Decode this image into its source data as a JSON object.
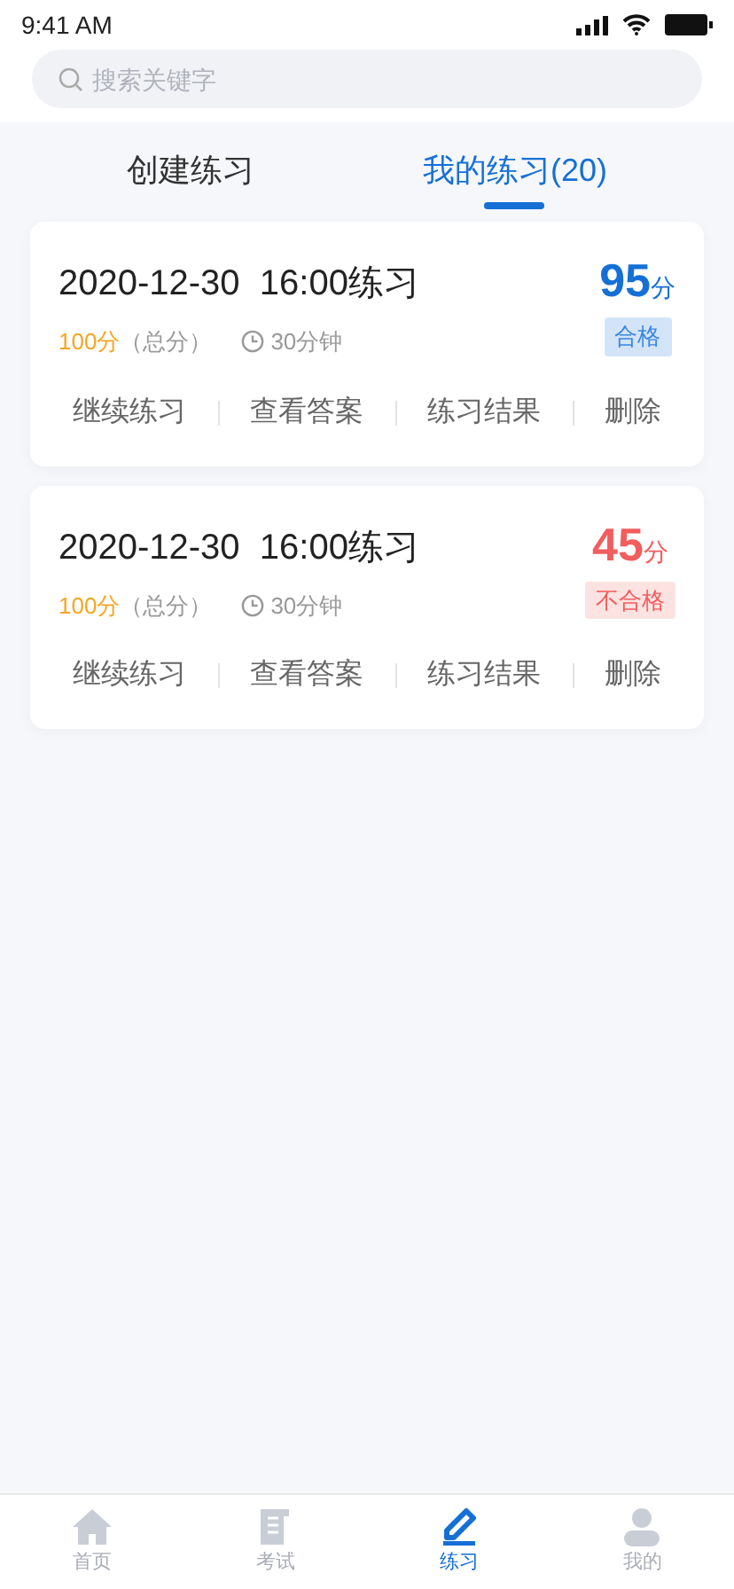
{
  "status_bar": {
    "time": "9:41 AM"
  },
  "search": {
    "placeholder": "搜索关键字"
  },
  "tabs": [
    {
      "label": "创建练习",
      "selected": false
    },
    {
      "label": "我的练习(20)",
      "selected": true
    }
  ],
  "records": [
    {
      "title": "2020-12-30  16:00练习",
      "total": "100分",
      "total_note": "（总分）",
      "duration": "30分钟",
      "score": "95",
      "score_unit": "分",
      "result": "合格",
      "passed": true,
      "actions": [
        "继续练习",
        "查看答案",
        "练习结果",
        "删除"
      ]
    },
    {
      "title": "2020-12-30  16:00练习",
      "total": "100分",
      "total_note": "（总分）",
      "duration": "30分钟",
      "score": "45",
      "score_unit": "分",
      "result": "不合格",
      "passed": false,
      "actions": [
        "继续练习",
        "查看答案",
        "练习结果",
        "删除"
      ]
    }
  ],
  "bottom_nav": [
    {
      "label": "首页",
      "selected": false
    },
    {
      "label": "考试",
      "selected": false
    },
    {
      "label": "练习",
      "selected": true
    },
    {
      "label": "我的",
      "selected": false
    }
  ]
}
